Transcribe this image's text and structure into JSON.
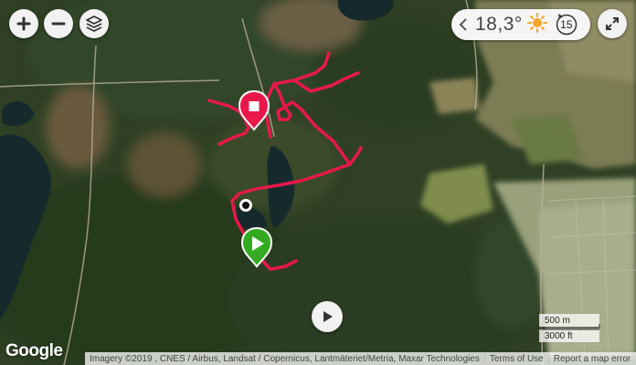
{
  "map": {
    "type": "satellite",
    "route_color": "#e8194a",
    "markers": [
      {
        "name": "start",
        "color": "#33aa22",
        "icon": "play-icon"
      },
      {
        "name": "finish",
        "color": "#e8194a",
        "icon": "stop-icon"
      },
      {
        "name": "current-position",
        "color": "#111111"
      }
    ]
  },
  "controls": {
    "zoom_in_icon": "plus-icon",
    "zoom_out_icon": "minus-icon",
    "layers_icon": "layers-icon",
    "fullscreen_icon": "expand-icon",
    "play_icon": "play-icon"
  },
  "weather": {
    "temperature": "18,3°",
    "condition_icon": "sun-icon",
    "wind_speed": "15",
    "wind_icon": "wind-arrow-icon"
  },
  "scale": {
    "metric": "500 m",
    "imperial": "3000 ft"
  },
  "footer": {
    "logo": "Google",
    "attribution": "Imagery ©2019 , CNES / Airbus, Landsat / Copernicus, Lantmäteriet/Metria, Maxar Technologies",
    "terms": "Terms of Use",
    "report": "Report a map error"
  }
}
